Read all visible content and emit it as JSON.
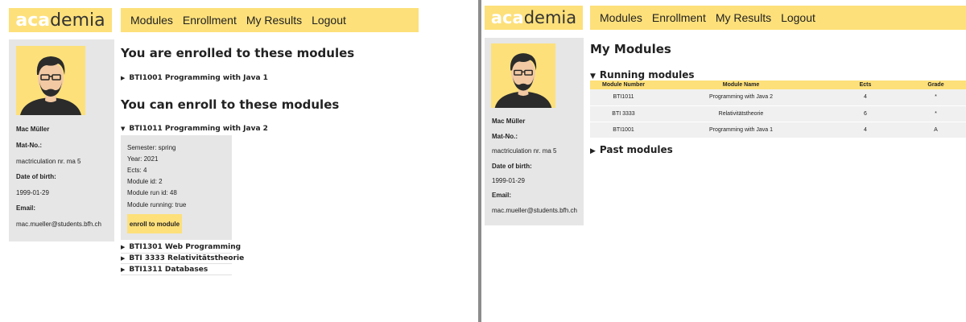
{
  "logo": {
    "aca": "aca",
    "demia": "demia"
  },
  "nav": [
    "Modules",
    "Enrollment",
    "My Results",
    "Logout"
  ],
  "profile": {
    "name": "Mac Müller",
    "matno_label": "Mat-No.:",
    "matno": "mactriculation nr. ma 5",
    "dob_label": "Date of birth:",
    "dob": "1999-01-29",
    "email_label": "Email:",
    "email": "mac.mueller@students.bfh.ch"
  },
  "enrollment": {
    "enrolled_title": "You are enrolled to these modules",
    "enrolled": [
      "BTI1001 Programming with Java 1"
    ],
    "available_title": "You can enroll to these modules",
    "expanded_module": "BTI1011 Programming with Java 2",
    "details": [
      "Semester: spring",
      "Year: 2021",
      "Ects: 4",
      "Module id: 2",
      "Module run id: 48",
      "Module running: true"
    ],
    "enroll_button": "enroll to module",
    "other_modules": [
      "BTI1301 Web Programming",
      "BTI 3333 Relativitätstheorie",
      "BTI1311 Databases"
    ]
  },
  "my_modules": {
    "title": "My Modules",
    "running_title": "Running modules",
    "columns": [
      "Module Number",
      "Module Name",
      "Ects",
      "Grade"
    ],
    "rows": [
      [
        "BTI1011",
        "Programming with Java 2",
        "4",
        "*"
      ],
      [
        "BTI 3333",
        "Relativitätstheorie",
        "6",
        "*"
      ],
      [
        "BTI1001",
        "Programming with Java 1",
        "4",
        "A"
      ]
    ],
    "past_title": "Past modules"
  },
  "colors": {
    "accent": "#fde07a",
    "panel": "#e6e6e6",
    "divider": "#8c8c8c"
  },
  "triangles": {
    "collapsed": "▶",
    "expanded": "▼"
  }
}
